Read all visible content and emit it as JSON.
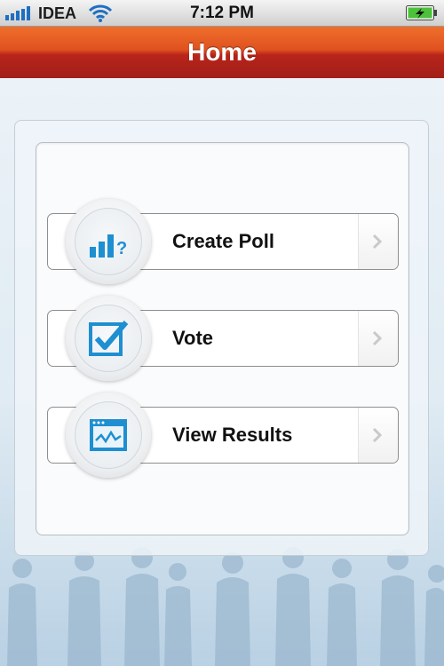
{
  "status_bar": {
    "carrier": "IDEA",
    "time": "7:12 PM"
  },
  "nav": {
    "title": "Home"
  },
  "menu": [
    {
      "label": "Create Poll",
      "icon": "poll-chart-icon"
    },
    {
      "label": "Vote",
      "icon": "checkbox-icon"
    },
    {
      "label": "View Results",
      "icon": "results-window-icon"
    }
  ],
  "colors": {
    "nav_top": "#ef6f2b",
    "nav_bottom": "#a11f18",
    "icon_blue": "#1e8fd0"
  }
}
